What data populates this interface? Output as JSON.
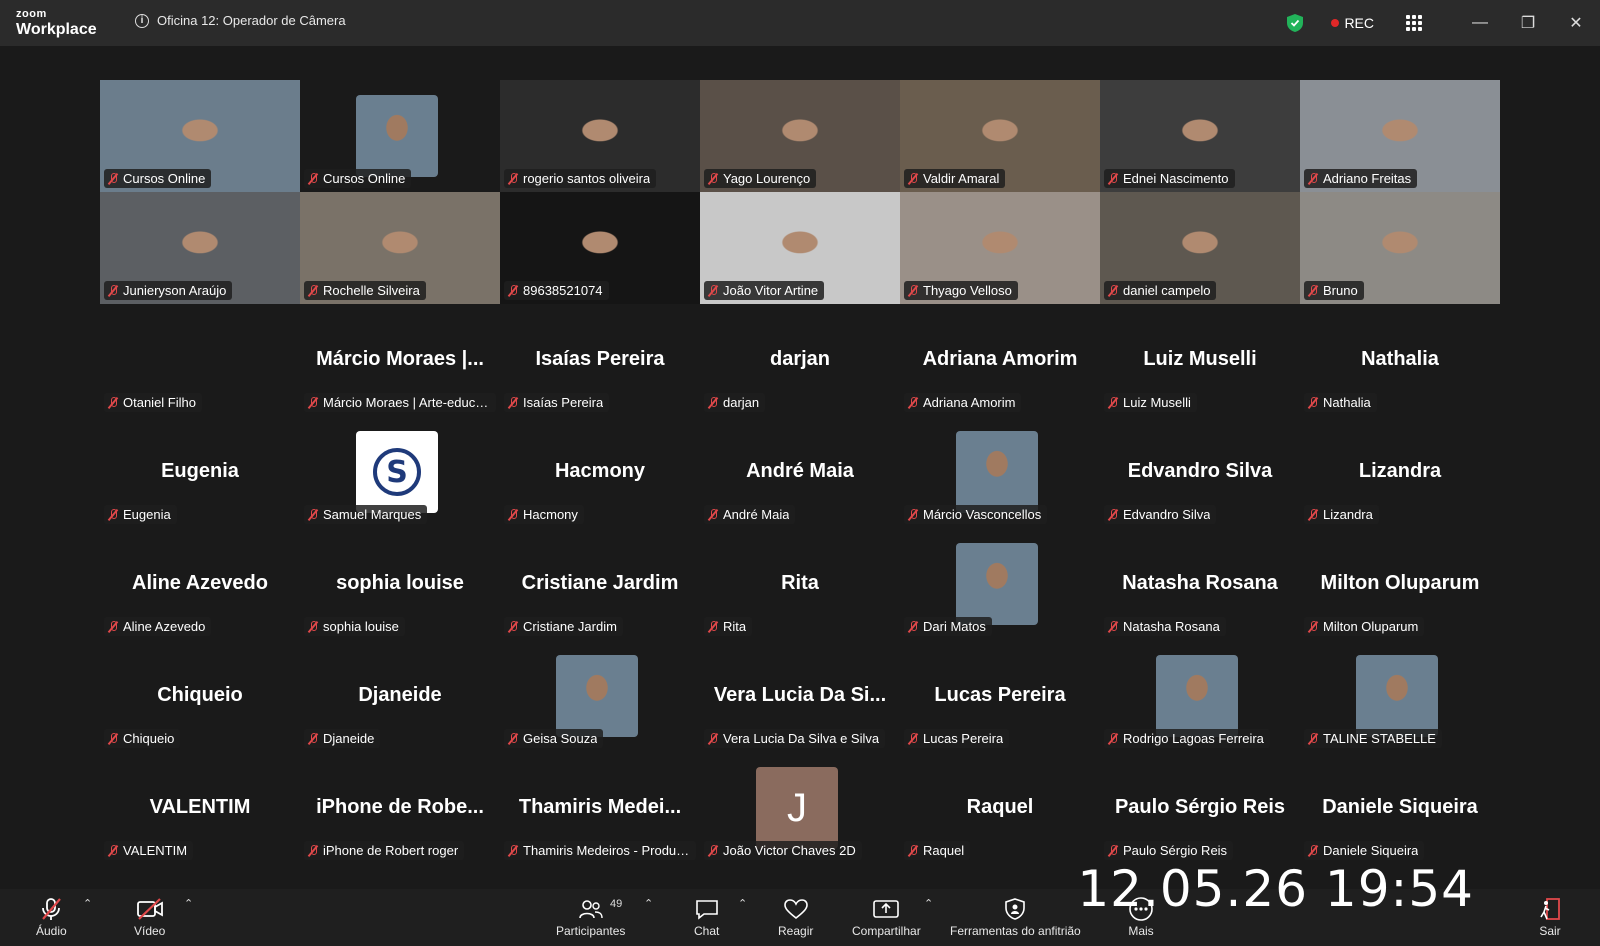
{
  "app": {
    "brand_top": "zoom",
    "brand_bottom": "Workplace",
    "meeting_title": "Oficina 12: Operador de Câmera",
    "rec_label": "REC"
  },
  "tiles": [
    {
      "name": "Cursos Online",
      "type": "video"
    },
    {
      "name": "Cursos Online",
      "type": "avatar"
    },
    {
      "name": "rogerio santos oliveira",
      "type": "video"
    },
    {
      "name": "Yago Lourenço",
      "type": "video"
    },
    {
      "name": "Valdir Amaral",
      "type": "video"
    },
    {
      "name": "Ednei Nascimento",
      "type": "video"
    },
    {
      "name": "Adriano Freitas",
      "type": "video"
    },
    {
      "name": "Junieryson Araújo",
      "type": "video"
    },
    {
      "name": "Rochelle Silveira",
      "type": "video"
    },
    {
      "name": "89638521074",
      "type": "video"
    },
    {
      "name": "João Vitor Artine",
      "type": "video"
    },
    {
      "name": "Thyago Velloso",
      "type": "video"
    },
    {
      "name": "daniel campelo",
      "type": "video"
    },
    {
      "name": "Bruno",
      "type": "video"
    },
    {
      "name": "Otaniel Filho",
      "type": "blank"
    },
    {
      "name": "Márcio Moraes | Arte-educa...",
      "big": "Márcio Moraes |...",
      "type": "text"
    },
    {
      "name": "Isaías Pereira",
      "big": "Isaías Pereira",
      "type": "text"
    },
    {
      "name": "darjan",
      "big": "darjan",
      "type": "text"
    },
    {
      "name": "Adriana Amorim",
      "big": "Adriana Amorim",
      "type": "text"
    },
    {
      "name": "Luiz Muselli",
      "big": "Luiz Muselli",
      "type": "text"
    },
    {
      "name": "Nathalia",
      "big": "Nathalia",
      "type": "text"
    },
    {
      "name": "Eugenia",
      "big": "Eugenia",
      "type": "text"
    },
    {
      "name": "Samuel Marques",
      "type": "avatar-s"
    },
    {
      "name": "Hacmony",
      "big": "Hacmony",
      "type": "text"
    },
    {
      "name": "André Maia",
      "big": "André Maia",
      "type": "text"
    },
    {
      "name": "Márcio Vasconcellos",
      "type": "avatar"
    },
    {
      "name": "Edvandro Silva",
      "big": "Edvandro Silva",
      "type": "text"
    },
    {
      "name": "Lizandra",
      "big": "Lizandra",
      "type": "text"
    },
    {
      "name": "Aline Azevedo",
      "big": "Aline Azevedo",
      "type": "text"
    },
    {
      "name": "sophia louise",
      "big": "sophia louise",
      "type": "text"
    },
    {
      "name": "Cristiane Jardim",
      "big": "Cristiane Jardim",
      "type": "text"
    },
    {
      "name": "Rita",
      "big": "Rita",
      "type": "text"
    },
    {
      "name": "Dari Matos",
      "type": "avatar"
    },
    {
      "name": "Natasha Rosana",
      "big": "Natasha Rosana",
      "type": "text"
    },
    {
      "name": "Milton Oluparum",
      "big": "Milton Oluparum",
      "type": "text"
    },
    {
      "name": "Chiqueio",
      "big": "Chiqueio",
      "type": "text"
    },
    {
      "name": "Djaneide",
      "big": "Djaneide",
      "type": "text"
    },
    {
      "name": "Geisa Souza",
      "type": "avatar"
    },
    {
      "name": "Vera Lucia Da Silva e Silva",
      "big": "Vera Lucia Da Si...",
      "type": "text"
    },
    {
      "name": "Lucas Pereira",
      "big": "Lucas Pereira",
      "type": "text"
    },
    {
      "name": "Rodrigo Lagoas Ferreira",
      "type": "avatar"
    },
    {
      "name": "TALINE STABELLE",
      "type": "avatar"
    },
    {
      "name": "VALENTIM",
      "big": "VALENTIM",
      "type": "text"
    },
    {
      "name": "iPhone de Robert roger",
      "big": "iPhone de Robe...",
      "type": "text"
    },
    {
      "name": "Thamiris Medeiros - Produto...",
      "big": "Thamiris Medei...",
      "type": "text"
    },
    {
      "name": "João Victor Chaves 2D",
      "letter": "J",
      "type": "letter"
    },
    {
      "name": "Raquel",
      "big": "Raquel",
      "type": "text"
    },
    {
      "name": "Paulo Sérgio Reis",
      "big": "Paulo Sérgio Reis",
      "type": "text"
    },
    {
      "name": "Daniele Siqueira",
      "big": "Daniele Siqueira",
      "type": "text"
    }
  ],
  "toolbar": {
    "audio": "Áudio",
    "video": "Vídeo",
    "participants": "Participantes",
    "participants_count": "49",
    "chat": "Chat",
    "react": "Reagir",
    "share": "Compartilhar",
    "host_tools": "Ferramentas do anfitrião",
    "more": "Mais",
    "leave": "Sair"
  },
  "timestamp": "12.05.26 19:54"
}
